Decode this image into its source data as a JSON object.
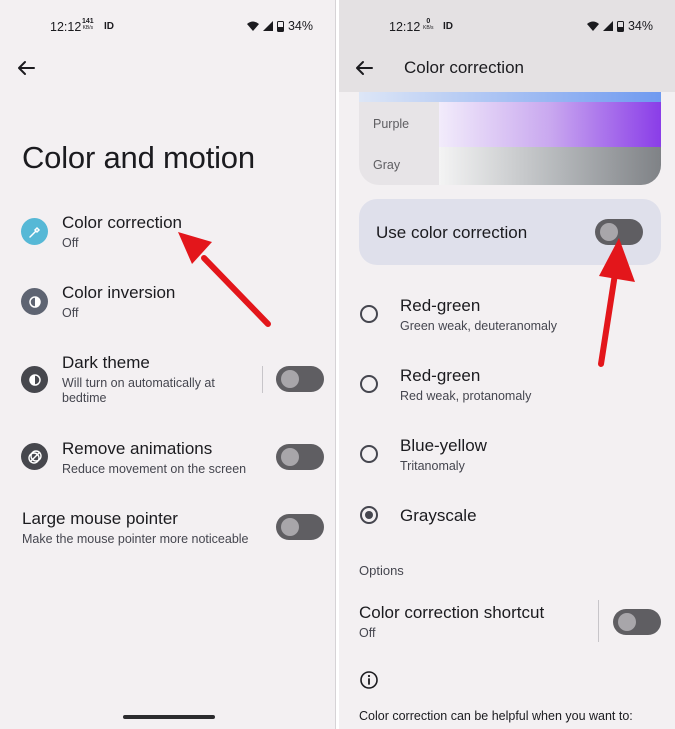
{
  "left": {
    "status": {
      "time": "12:12",
      "speed_value": "141",
      "speed_unit": "KB/s",
      "battery": "34%"
    },
    "title": "Color and motion",
    "items": [
      {
        "title": "Color correction",
        "subtitle": "Off"
      },
      {
        "title": "Color inversion",
        "subtitle": "Off"
      },
      {
        "title": "Dark theme",
        "subtitle": "Will turn on automatically at bedtime"
      },
      {
        "title": "Remove animations",
        "subtitle": "Reduce movement on the screen"
      },
      {
        "title": "Large mouse pointer",
        "subtitle": "Make the mouse pointer more noticeable"
      }
    ]
  },
  "right": {
    "status": {
      "time": "12:12",
      "speed_value": "0",
      "speed_unit": "KB/s",
      "battery": "34%"
    },
    "title": "Color correction",
    "preview": {
      "purple_label": "Purple",
      "gray_label": "Gray"
    },
    "use_label": "Use color correction",
    "modes": [
      {
        "title": "Red-green",
        "subtitle": "Green weak, deuteranomaly",
        "selected": false
      },
      {
        "title": "Red-green",
        "subtitle": "Red weak, protanomaly",
        "selected": false
      },
      {
        "title": "Blue-yellow",
        "subtitle": "Tritanomaly",
        "selected": false
      },
      {
        "title": "Grayscale",
        "subtitle": "",
        "selected": true
      }
    ],
    "options_header": "Options",
    "shortcut": {
      "title": "Color correction shortcut",
      "subtitle": "Off"
    },
    "footer": "Color correction can be helpful when you want to:"
  },
  "colors": {
    "annotation_arrow": "#e3161b",
    "toggle_track": "#5f5e62",
    "color_correction_icon": "#56b8d6"
  }
}
